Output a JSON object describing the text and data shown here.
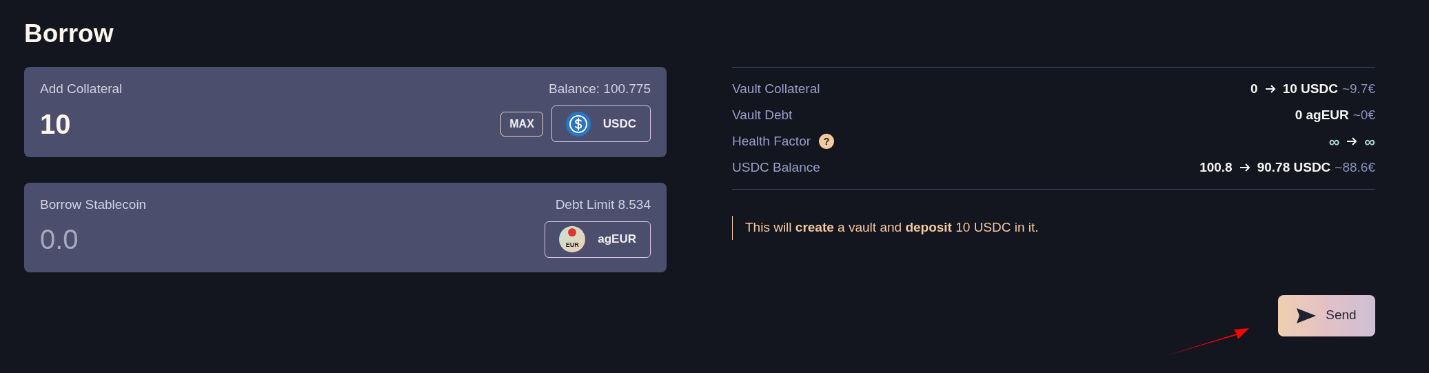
{
  "title": "Borrow",
  "inputs": [
    {
      "label": "Add Collateral",
      "info": "Balance: 100.775",
      "value": "10",
      "max_button": "MAX",
      "token": {
        "symbol": "USDC",
        "kind": "usdc"
      }
    },
    {
      "label": "Borrow Stablecoin",
      "info": "Debt Limit 8.534",
      "placeholder": "0.0",
      "token": {
        "symbol": "agEUR",
        "kind": "ageur",
        "icon_text": "EUR"
      }
    }
  ],
  "summary": [
    {
      "label": "Vault Collateral",
      "kind": "amount",
      "from": "0",
      "to": "10 USDC",
      "approx": "~9.7€"
    },
    {
      "label": "Vault Debt",
      "kind": "amount",
      "to": "0 agEUR",
      "approx": "~0€"
    },
    {
      "label": "Health Factor",
      "help": "?",
      "kind": "infinite",
      "from": "∞",
      "to": "∞"
    },
    {
      "label": "USDC Balance",
      "kind": "amount",
      "from": "100.8",
      "to": "90.78 USDC",
      "approx": "~88.6€"
    }
  ],
  "note": "This will **create** a vault and **deposit** 10 USDC in it.",
  "send_button": "Send"
}
